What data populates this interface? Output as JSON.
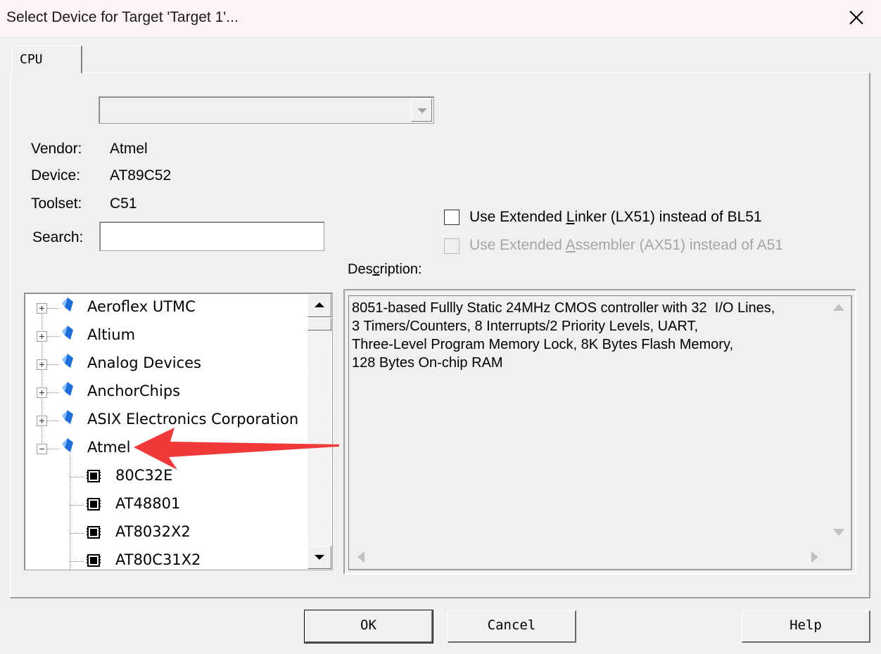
{
  "window": {
    "title": "Select Device for Target 'Target 1'..."
  },
  "tabs": [
    {
      "label": "CPU",
      "active": true
    }
  ],
  "device_database": {
    "selected": ""
  },
  "info": {
    "vendor_label": "Vendor:",
    "vendor_value": "Atmel",
    "device_label": "Device:",
    "device_value": "AT89C52",
    "toolset_label": "Toolset:",
    "toolset_value": "C51",
    "search_label": "Search:",
    "search_value": ""
  },
  "options": {
    "lx51": {
      "label_pre": "Use Extended ",
      "label_access": "L",
      "label_post": "inker (LX51) instead of BL51",
      "checked": false,
      "enabled": true
    },
    "ax51": {
      "label_pre": "Use Extended ",
      "label_access": "A",
      "label_post": "ssembler (AX51) instead of A51",
      "checked": false,
      "enabled": false
    }
  },
  "description": {
    "label_pre": "Des",
    "label_access": "c",
    "label_post": "ription:",
    "lines": [
      "8051-based Fullly Static 24MHz CMOS controller with 32  I/O Lines,",
      "3 Timers/Counters, 8 Interrupts/2 Priority Levels, UART,",
      "Three-Level Program Memory Lock, 8K Bytes Flash Memory,",
      "128 Bytes On-chip RAM"
    ]
  },
  "tree": {
    "vendors": [
      {
        "name": "Aeroflex UTMC",
        "expanded": false
      },
      {
        "name": "Altium",
        "expanded": false
      },
      {
        "name": "Analog Devices",
        "expanded": false
      },
      {
        "name": "AnchorChips",
        "expanded": false
      },
      {
        "name": "ASIX Electronics Corporation",
        "expanded": false
      },
      {
        "name": "Atmel",
        "expanded": true
      }
    ],
    "devices": [
      "80C32E",
      "AT48801",
      "AT8032X2",
      "AT80C31X2"
    ]
  },
  "buttons": {
    "ok": "OK",
    "cancel": "Cancel",
    "help": "Help"
  },
  "colors": {
    "annotation_arrow": "#f03a3a",
    "vendor_icon": "#1e6fd9"
  }
}
